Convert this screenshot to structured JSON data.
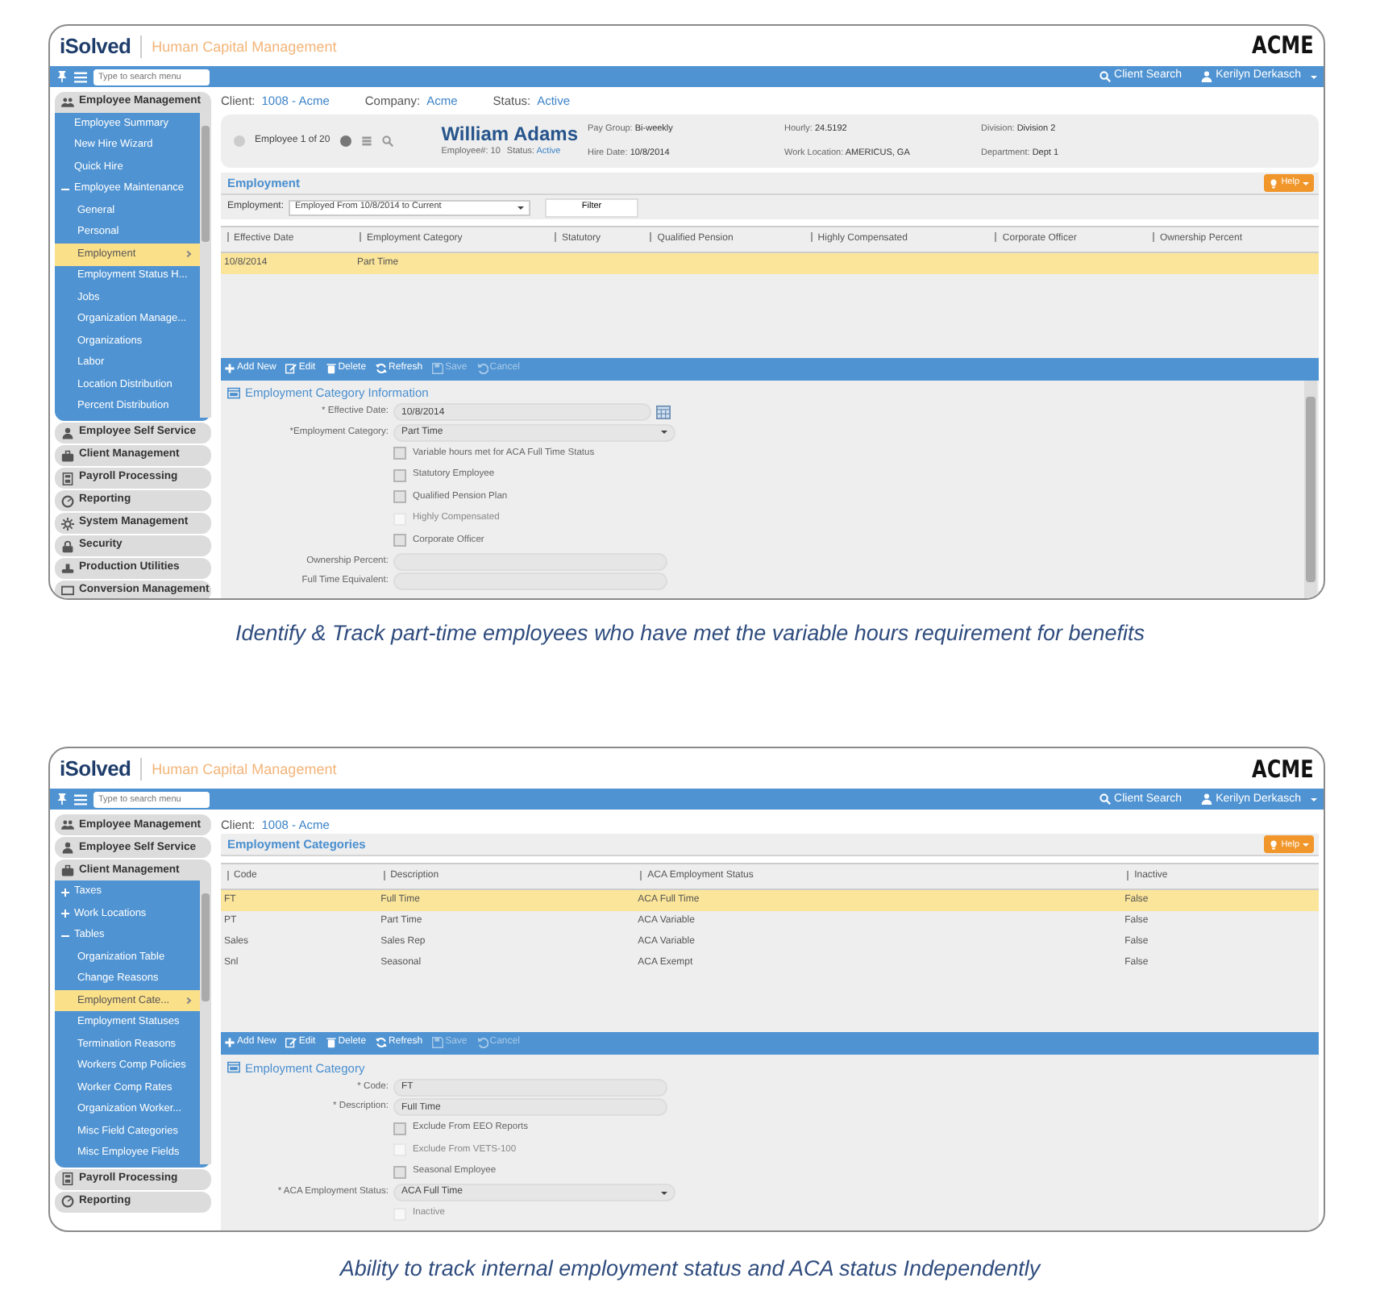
{
  "screens": [
    {
      "header": {
        "brand": "iSolved",
        "product": "Human Capital Management",
        "client_logo": "ACME"
      },
      "topbar": {
        "search_placeholder": "Type to search menu",
        "client_search": "Client Search",
        "user": "Kerilyn Derkasch"
      },
      "sidebar": [
        {
          "kind": "people",
          "label": "Employee Management",
          "expanded": true,
          "children": [
            {
              "label": "Employee Summary",
              "selected": false
            },
            {
              "label": "New Hire Wizard",
              "selected": false
            },
            {
              "label": "Quick Hire",
              "selected": false
            },
            {
              "label": "Employee Maintenance",
              "selected": false,
              "expanded": true,
              "children": [
                {
                  "label": "General",
                  "selected": false
                },
                {
                  "label": "Personal",
                  "selected": false
                },
                {
                  "label": "Employment",
                  "selected": true
                },
                {
                  "label": "Employment Status H...",
                  "selected": false
                },
                {
                  "label": "Jobs",
                  "selected": false
                },
                {
                  "label": "Organization Manage...",
                  "selected": false
                },
                {
                  "label": "Organizations",
                  "selected": false
                },
                {
                  "label": "Labor",
                  "selected": false
                },
                {
                  "label": "Location Distribution",
                  "selected": false
                },
                {
                  "label": "Percent Distribution",
                  "selected": false
                }
              ]
            }
          ]
        },
        {
          "kind": "person",
          "label": "Employee Self Service",
          "expanded": false
        },
        {
          "kind": "briefcase",
          "label": "Client Management",
          "expanded": false
        },
        {
          "kind": "calculator",
          "label": "Payroll Processing",
          "expanded": false
        },
        {
          "kind": "gauge",
          "label": "Reporting",
          "expanded": false
        },
        {
          "kind": "gear",
          "label": "System Management",
          "expanded": false
        },
        {
          "kind": "lock",
          "label": "Security",
          "expanded": false
        },
        {
          "kind": "stamp",
          "label": "Production Utilities",
          "expanded": false
        },
        {
          "kind": "monitor",
          "label": "Conversion Management",
          "expanded": false
        }
      ],
      "context": [
        {
          "label": "Client:",
          "value": "1008 - Acme"
        },
        {
          "label": "Company:",
          "value": "Acme"
        },
        {
          "label": "Status:",
          "value": "Active"
        }
      ],
      "employee": {
        "position": "Employee 1 of 20",
        "name": "William Adams",
        "meta": [
          {
            "label": "Employee#:",
            "value": "10",
            "highlight": false
          },
          {
            "label": "Status:",
            "value": "Active",
            "highlight": true
          }
        ],
        "details": [
          [
            {
              "label": "Pay Group:",
              "value": "Bi-weekly"
            },
            {
              "label": "Hire Date:",
              "value": "10/8/2014"
            }
          ],
          [
            {
              "label": "Hourly:",
              "value": "24.5192"
            },
            {
              "label": "Work Location:",
              "value": "AMERICUS, GA"
            }
          ],
          [
            {
              "label": "Division:",
              "value": "Division 2"
            },
            {
              "label": "Department:",
              "value": "Dept 1"
            }
          ]
        ]
      },
      "section": {
        "title": "Employment",
        "help": "Help"
      },
      "filter": {
        "label": "Employment:",
        "value": "Employed From 10/8/2014 to Current",
        "button": "Filter"
      },
      "table": {
        "columns": [
          "Effective Date",
          "Employment Category",
          "Statutory",
          "Qualified Pension",
          "Highly Compensated",
          "Corporate Officer",
          "Ownership Percent"
        ],
        "rows": [
          {
            "cells": [
              "10/8/2014",
              "Part Time",
              "",
              "",
              "",
              "",
              ""
            ],
            "selected": true
          }
        ]
      },
      "toolbar": [
        {
          "kind": "add",
          "label": "Add New",
          "disabled": false
        },
        {
          "kind": "edit",
          "label": "Edit",
          "disabled": false
        },
        {
          "kind": "delete",
          "label": "Delete",
          "disabled": false
        },
        {
          "kind": "refresh",
          "label": "Refresh",
          "disabled": false
        },
        {
          "kind": "save",
          "label": "Save",
          "disabled": true
        },
        {
          "kind": "cancel",
          "label": "Cancel",
          "disabled": true
        }
      ],
      "form": {
        "title": "Employment Category Information",
        "scrollable": true,
        "fields": [
          {
            "kind": "date",
            "label": "* Effective Date:",
            "value": "10/8/2014"
          },
          {
            "kind": "select",
            "label": "*Employment Category:",
            "value": "Part Time"
          },
          {
            "kind": "checkbox",
            "label": "Variable hours met for ACA Full Time Status",
            "checked": false,
            "disabled": false
          },
          {
            "kind": "checkbox",
            "label": "Statutory Employee",
            "checked": false,
            "disabled": false
          },
          {
            "kind": "checkbox",
            "label": "Qualified Pension Plan",
            "checked": false,
            "disabled": false
          },
          {
            "kind": "checkbox",
            "label": "Highly Compensated",
            "checked": false,
            "disabled": true
          },
          {
            "kind": "checkbox",
            "label": "Corporate Officer",
            "checked": false,
            "disabled": false
          },
          {
            "kind": "text",
            "label": "Ownership Percent:"
          },
          {
            "kind": "text",
            "label": "Full Time Equivalent:"
          }
        ]
      },
      "caption": "Identify & Track part-time employees who have met the variable hours requirement for benefits"
    },
    {
      "header": {
        "brand": "iSolved",
        "product": "Human Capital Management",
        "client_logo": "ACME"
      },
      "topbar": {
        "search_placeholder": "Type to search menu",
        "client_search": "Client Search",
        "user": "Kerilyn Derkasch"
      },
      "sidebar": [
        {
          "kind": "people",
          "label": "Employee Management",
          "expanded": false
        },
        {
          "kind": "person",
          "label": "Employee Self Service",
          "expanded": false
        },
        {
          "kind": "briefcase",
          "label": "Client Management",
          "expanded": true,
          "children": [
            {
              "label": "Taxes",
              "selected": false,
              "expanded": false
            },
            {
              "label": "Work Locations",
              "selected": false,
              "expanded": false
            },
            {
              "label": "Tables",
              "selected": false,
              "expanded": true,
              "children": [
                {
                  "label": "Organization Table",
                  "selected": false
                },
                {
                  "label": "Change Reasons",
                  "selected": false
                },
                {
                  "label": "Employment Cate...",
                  "selected": true
                },
                {
                  "label": "Employment Statuses",
                  "selected": false
                },
                {
                  "label": "Termination Reasons",
                  "selected": false
                },
                {
                  "label": "Workers Comp Policies",
                  "selected": false
                },
                {
                  "label": "Worker Comp Rates",
                  "selected": false
                },
                {
                  "label": "Organization Worker...",
                  "selected": false
                },
                {
                  "label": "Misc Field Categories",
                  "selected": false
                },
                {
                  "label": "Misc Employee Fields",
                  "selected": false
                }
              ]
            }
          ]
        },
        {
          "kind": "calculator",
          "label": "Payroll Processing",
          "expanded": false
        },
        {
          "kind": "gauge",
          "label": "Reporting",
          "expanded": false
        }
      ],
      "context": [
        {
          "label": "Client:",
          "value": "1008 - Acme"
        }
      ],
      "section": {
        "title": "Employment Categories",
        "help": "Help"
      },
      "table": {
        "columns": [
          "Code",
          "Description",
          "ACA Employment Status",
          "Inactive"
        ],
        "rows": [
          {
            "cells": [
              "FT",
              "Full Time",
              "ACA Full Time",
              "False"
            ],
            "selected": true
          },
          {
            "cells": [
              "PT",
              "Part Time",
              "ACA Variable",
              "False"
            ],
            "selected": false
          },
          {
            "cells": [
              "Sales",
              "Sales Rep",
              "ACA Variable",
              "False"
            ],
            "selected": false
          },
          {
            "cells": [
              "Snl",
              "Seasonal",
              "ACA Exempt",
              "False"
            ],
            "selected": false
          }
        ]
      },
      "toolbar": [
        {
          "kind": "add",
          "label": "Add New",
          "disabled": false
        },
        {
          "kind": "edit",
          "label": "Edit",
          "disabled": false
        },
        {
          "kind": "delete",
          "label": "Delete",
          "disabled": false
        },
        {
          "kind": "refresh",
          "label": "Refresh",
          "disabled": false
        },
        {
          "kind": "save",
          "label": "Save",
          "disabled": true
        },
        {
          "kind": "cancel",
          "label": "Cancel",
          "disabled": true
        }
      ],
      "form": {
        "title": "Employment Category",
        "scrollable": false,
        "fields": [
          {
            "kind": "text",
            "label": "* Code:",
            "value": "FT"
          },
          {
            "kind": "text",
            "label": "* Description:",
            "value": "Full Time"
          },
          {
            "kind": "checkbox",
            "label": "Exclude From EEO Reports",
            "checked": false,
            "disabled": false
          },
          {
            "kind": "checkbox",
            "label": "Exclude From VETS-100",
            "checked": false,
            "disabled": true
          },
          {
            "kind": "checkbox",
            "label": "Seasonal Employee",
            "checked": false,
            "disabled": false
          },
          {
            "kind": "select",
            "label": "* ACA Employment Status:",
            "value": "ACA Full Time"
          },
          {
            "kind": "checkbox",
            "label": "Inactive",
            "checked": false,
            "disabled": true
          }
        ]
      },
      "caption": "Ability to track internal employment status and ACA status Independently"
    }
  ]
}
